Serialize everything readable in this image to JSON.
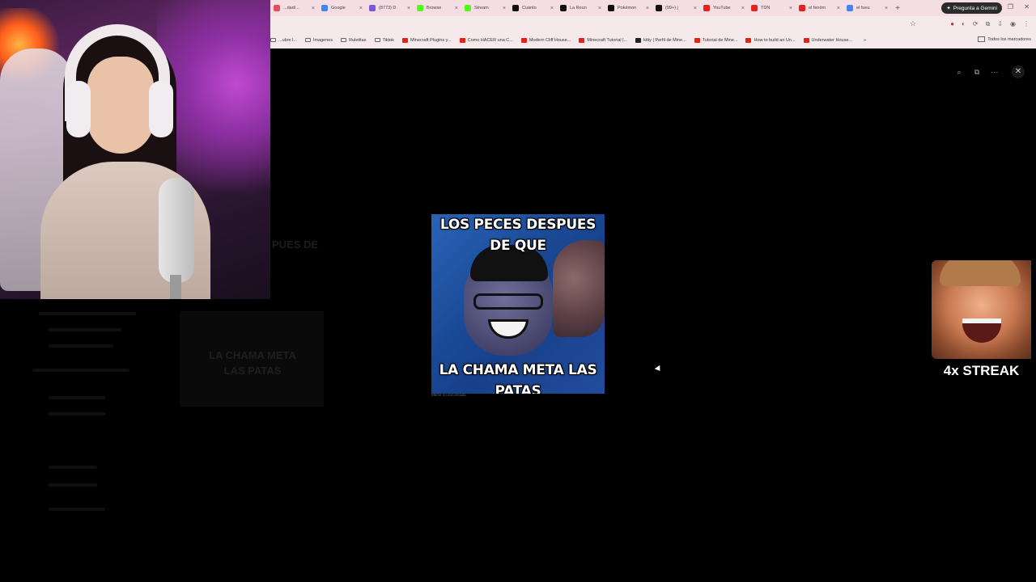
{
  "browser": {
    "tabs": [
      {
        "label": "...dad/...",
        "color": "#e84b5a"
      },
      {
        "label": "Google",
        "color": "#4285f4"
      },
      {
        "label": "(8773) D",
        "color": "#7a5bd6"
      },
      {
        "label": "Browse",
        "color": "#53fc18"
      },
      {
        "label": "Stream",
        "color": "#53fc18"
      },
      {
        "label": "Cuánto",
        "color": "#111111"
      },
      {
        "label": "La Reun",
        "color": "#111111"
      },
      {
        "label": "Pokémon",
        "color": "#111111"
      },
      {
        "label": "(99+) j",
        "color": "#111111"
      },
      {
        "label": "YouTube",
        "color": "#e62117"
      },
      {
        "label": "TDN",
        "color": "#e62117"
      },
      {
        "label": "el fenóm",
        "color": "#e62117"
      },
      {
        "label": "el fueu",
        "color": "#4285f4"
      }
    ],
    "gemini_button": "Pregunta a Gemini",
    "bookmarks": [
      {
        "label": "...ubre l...",
        "kind": "folder"
      },
      {
        "label": "Imagenes",
        "kind": "folder"
      },
      {
        "label": "Ruletitas",
        "kind": "folder"
      },
      {
        "label": "Tiktok",
        "kind": "folder"
      },
      {
        "label": "Minecraft Plugins y...",
        "kind": "yt"
      },
      {
        "label": "Como HACER una C...",
        "kind": "yt"
      },
      {
        "label": "Modern Cliff House...",
        "kind": "yt"
      },
      {
        "label": "Minecraft Tutorial |...",
        "kind": "yt"
      },
      {
        "label": "kitty | Perfil de Mine...",
        "kind": "site"
      },
      {
        "label": "Tutorial de Mine...",
        "kind": "yt"
      },
      {
        "label": "How to build an Un...",
        "kind": "yt"
      },
      {
        "label": "Underwater House...",
        "kind": "yt"
      }
    ],
    "all_bookmarks": "Todos los marcadores"
  },
  "viewer": {
    "meme_top_text": "LOS PECES DESPUES DE QUE",
    "meme_bottom_text": "LA CHAMA META LAS PATAS",
    "credit": "Meme no encontrado",
    "icons": [
      "zoom-icon",
      "open-external-icon",
      "more-icon",
      "close-icon"
    ]
  },
  "background": {
    "peek_text": "PUES DE",
    "dim_title": "LA CHAMA META LAS PATAS"
  },
  "alert": {
    "streak_text": "4x STREAK"
  },
  "colors": {
    "chrome_bg": "#f6e9ec",
    "viewer_bg": "#000000",
    "gemini_bg": "#2b2b2b"
  }
}
